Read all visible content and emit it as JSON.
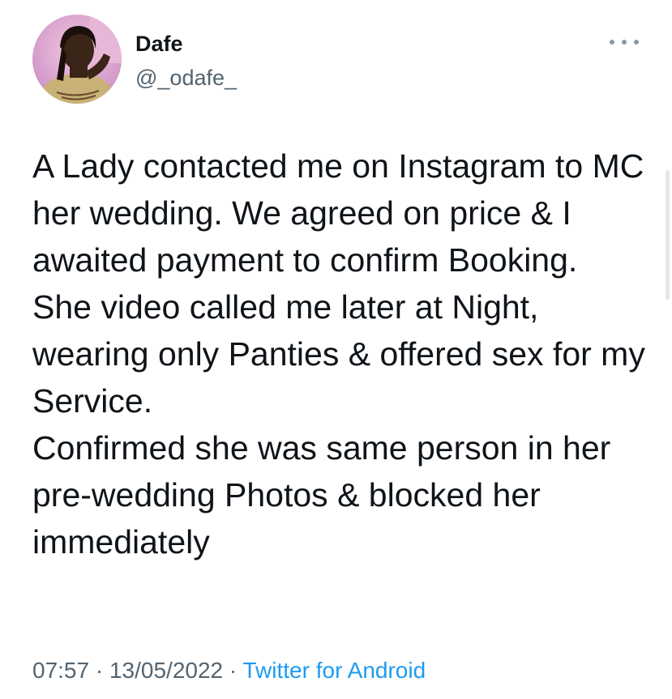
{
  "tweet": {
    "author": {
      "display_name": "Dafe",
      "handle": "@_odafe_",
      "avatar_icon": "profile-photo"
    },
    "more_icon": "ellipsis-icon",
    "text": "A Lady contacted me on Instagram to MC her wedding. We agreed on price & I awaited payment to confirm Booking.\nShe video called me later at Night, wearing only Panties & offered sex for my Service.\nConfirmed she was same  person in her pre-wedding Photos & blocked her immediately",
    "time": "07:57",
    "separator": "·",
    "date": "13/05/2022",
    "source": "Twitter for Android"
  },
  "colors": {
    "text": "#0f1419",
    "secondary": "#536471",
    "link": "#1d9bf0"
  }
}
